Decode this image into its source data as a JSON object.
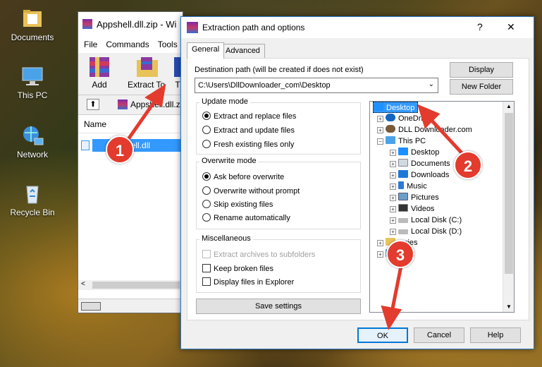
{
  "desktop": {
    "icons": [
      {
        "name": "documents",
        "label": "Documents"
      },
      {
        "name": "this-pc",
        "label": "This PC"
      },
      {
        "name": "network",
        "label": "Network"
      },
      {
        "name": "recycle-bin",
        "label": "Recycle Bin"
      }
    ]
  },
  "winrar": {
    "title": "Appshell.dll.zip - Wi",
    "menu": [
      "File",
      "Commands",
      "Tools"
    ],
    "toolbar": {
      "add": "Add",
      "extract": "Extract To",
      "test": "T"
    },
    "path": "Appshell.dll.zip",
    "column_name": "Name",
    "file": "appshell.dll"
  },
  "dialog": {
    "title": "Extraction path and options",
    "help": "?",
    "close": "✕",
    "tabs": [
      "General",
      "Advanced"
    ],
    "dest_label": "Destination path (will be created if does not exist)",
    "dest_value": "C:\\Users\\DllDownloader_com\\Desktop",
    "display_btn": "Display",
    "new_folder_btn": "New Folder",
    "update_mode": {
      "label": "Update mode",
      "options": [
        "Extract and replace files",
        "Extract and update files",
        "Fresh existing files only"
      ],
      "selected": 0
    },
    "overwrite_mode": {
      "label": "Overwrite mode",
      "options": [
        "Ask before overwrite",
        "Overwrite without prompt",
        "Skip existing files",
        "Rename automatically"
      ],
      "selected": 0
    },
    "misc": {
      "label": "Miscellaneous",
      "options": [
        "Extract archives to subfolders",
        "Keep broken files",
        "Display files in Explorer"
      ]
    },
    "save_settings": "Save settings",
    "tree": {
      "desktop": "Desktop",
      "onedrive": "OneDri",
      "user": "DLL Downloader.com",
      "thispc": "This PC",
      "children": [
        "Desktop",
        "Documents",
        "Downloads",
        "Music",
        "Pictures",
        "Videos",
        "Local Disk (C:)",
        "Local Disk (D:)"
      ],
      "libraries": "raries",
      "network": "work"
    },
    "ok": "OK",
    "cancel": "Cancel",
    "helpbtn": "Help"
  },
  "markers": [
    "1",
    "2",
    "3"
  ],
  "colors": {
    "marker": "#e33b2d",
    "selection": "#3399ff",
    "folder_blue": "#1e90ff"
  }
}
